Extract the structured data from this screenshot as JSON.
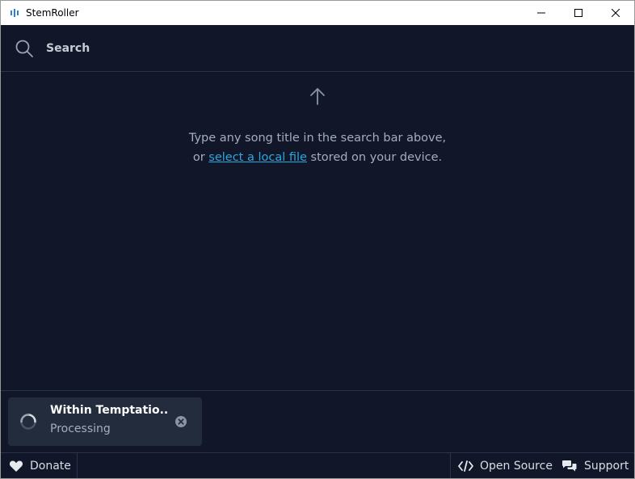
{
  "window": {
    "title": "StemRoller",
    "controls": [
      "minimize",
      "maximize",
      "close"
    ]
  },
  "search": {
    "placeholder": "Search",
    "value": ""
  },
  "main": {
    "hint_line1": "Type any song title in the search bar above,",
    "hint_prefix": "or ",
    "hint_link": "select a local file",
    "hint_suffix": " stored on your device."
  },
  "queue": {
    "items": [
      {
        "title": "Within Temptatio...",
        "status": "Processing"
      }
    ]
  },
  "footer": {
    "donate_label": "Donate",
    "opensource_label": "Open Source",
    "support_label": "Support"
  },
  "colors": {
    "background": "#111728",
    "card": "#222c3d",
    "link": "#2ba7e0",
    "muted_text": "#a3adbd",
    "border": "#2b3446"
  },
  "icons": [
    "app-logo-icon",
    "minimize-icon",
    "maximize-icon",
    "close-window-icon",
    "search-icon",
    "arrow-up-icon",
    "spinner-icon",
    "close-circle-icon",
    "heart-icon",
    "code-icon",
    "chat-bubbles-icon"
  ]
}
